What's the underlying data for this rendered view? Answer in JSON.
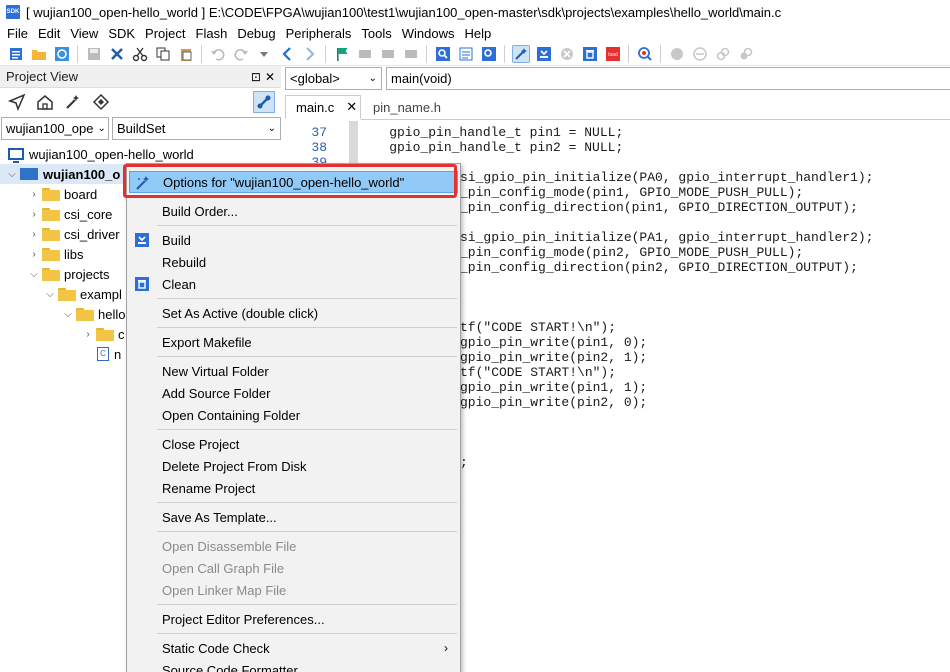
{
  "window": {
    "app_icon": "SDK",
    "title": "[ wujian100_open-hello_world ] E:\\CODE\\FPGA\\wujian100\\test1\\wujian100_open-master\\sdk\\projects\\examples\\hello_world\\main.c"
  },
  "menubar": [
    "File",
    "Edit",
    "View",
    "SDK",
    "Project",
    "Flash",
    "Debug",
    "Peripherals",
    "Tools",
    "Windows",
    "Help"
  ],
  "toolbar": {
    "icons": [
      "new-file-icon",
      "open-folder-icon",
      "refresh-icon",
      "save-icon",
      "close-icon",
      "cut-icon",
      "copy-icon",
      "paste-icon",
      "undo-icon",
      "redo-icon",
      "dropdown-icon",
      "back-icon",
      "forward-icon",
      "bookmark-icon",
      "bookmark-prev-icon",
      "bookmark-next-icon",
      "bookmark-clear-icon",
      "find-icon",
      "find-in-files-icon",
      "find-window-icon",
      "project-options-icon",
      "build-icon",
      "stop-icon",
      "clean-icon",
      "flash-icon",
      "debug-icon",
      "breakpoint-icon",
      "breakpoint-disable-icon",
      "link-icon",
      "unlink-icon"
    ]
  },
  "project_view": {
    "title": "Project View",
    "pin": "⊡",
    "close": "✕",
    "project_select": "wujian100_ope",
    "config_select": "BuildSet",
    "tree": [
      {
        "label": "wujian100_open-hello_world",
        "level": 0,
        "kind": "workspace"
      },
      {
        "label": "wujian100_o",
        "level": 1,
        "kind": "project",
        "expanded": true,
        "selected": true
      },
      {
        "label": "board",
        "level": 2,
        "kind": "folder"
      },
      {
        "label": "csi_core",
        "level": 2,
        "kind": "folder"
      },
      {
        "label": "csi_driver",
        "level": 2,
        "kind": "folder"
      },
      {
        "label": "libs",
        "level": 2,
        "kind": "folder"
      },
      {
        "label": "projects",
        "level": 2,
        "kind": "folder",
        "expanded": true
      },
      {
        "label": "exampl",
        "level": 3,
        "kind": "folder",
        "expanded": true
      },
      {
        "label": "hello",
        "level": 4,
        "kind": "folder",
        "expanded": true
      },
      {
        "label": "c",
        "level": 5,
        "kind": "folder"
      },
      {
        "label": "n",
        "level": 5,
        "kind": "file"
      }
    ]
  },
  "editor": {
    "scope_combo": "<global>",
    "function_combo": "main(void)",
    "tabs": [
      {
        "label": "main.c",
        "active": true,
        "close": "✕"
      },
      {
        "label": "pin_name.h",
        "active": false
      }
    ],
    "line_numbers": [
      "37",
      "38",
      "39"
    ],
    "code_lines": [
      {
        "text": "    gpio_pin_handle_t pin1 = NULL;"
      },
      {
        "text": "    gpio_pin_handle_t pin2 = NULL;"
      },
      {
        "text": ""
      },
      {
        "text": "si_gpio_pin_initialize(PA0, gpio_interrupt_handler1);"
      },
      {
        "text": "_pin_config_mode(pin1, GPIO_MODE_PUSH_PULL);"
      },
      {
        "text": "_pin_config_direction(pin1, GPIO_DIRECTION_OUTPUT);"
      },
      {
        "text": ""
      },
      {
        "text": "si_gpio_pin_initialize(PA1, gpio_interrupt_handler2);"
      },
      {
        "text": "_pin_config_mode(pin2, GPIO_MODE_PUSH_PULL);"
      },
      {
        "text": "_pin_config_direction(pin2, GPIO_DIRECTION_OUTPUT);"
      },
      {
        "text": ""
      },
      {
        "text": ""
      },
      {
        "text": ""
      },
      {
        "text": "tf(\"CODE START!\\n\");"
      },
      {
        "text": "gpio_pin_write(pin1, 0);"
      },
      {
        "text": "gpio_pin_write(pin2, 1);"
      },
      {
        "text": "tf(\"CODE START!\\n\");"
      },
      {
        "text": "gpio_pin_write(pin1, 1);"
      },
      {
        "text": "gpio_pin_write(pin2, 0);"
      },
      {
        "text": ""
      },
      {
        "text": ""
      },
      {
        "text": ""
      },
      {
        "text": ";"
      }
    ]
  },
  "context_menu": {
    "items": [
      {
        "label": "Options for \"wujian100_open-hello_world\"",
        "icon": "options-wand-icon",
        "highlighted": true
      },
      {
        "label": "Build Order...",
        "icon": ""
      },
      {
        "label": "Build",
        "icon": "build-icon"
      },
      {
        "label": "Rebuild",
        "icon": ""
      },
      {
        "label": "Clean",
        "icon": "clean-icon"
      },
      {
        "label": "Set As Active (double click)",
        "icon": ""
      },
      {
        "label": "Export Makefile",
        "icon": ""
      },
      {
        "label": "New Virtual Folder",
        "icon": ""
      },
      {
        "label": "Add Source Folder",
        "icon": ""
      },
      {
        "label": "Open Containing Folder",
        "icon": ""
      },
      {
        "label": "Close Project",
        "icon": ""
      },
      {
        "label": "Delete Project From Disk",
        "icon": ""
      },
      {
        "label": "Rename Project",
        "icon": ""
      },
      {
        "label": "Save As Template...",
        "icon": ""
      },
      {
        "label": "Open Disassemble File",
        "disabled": true
      },
      {
        "label": "Open Call Graph File",
        "disabled": true
      },
      {
        "label": "Open Linker Map File",
        "disabled": true
      },
      {
        "label": "Project Editor Preferences...",
        "icon": ""
      },
      {
        "label": "Static Code Check",
        "submenu": "›"
      },
      {
        "label": "Source Code Formatter",
        "icon": ""
      }
    ]
  },
  "colors": {
    "highlight": "#91c9f7",
    "annotation_box": "#e53030",
    "accent": "#2c6fd6"
  }
}
